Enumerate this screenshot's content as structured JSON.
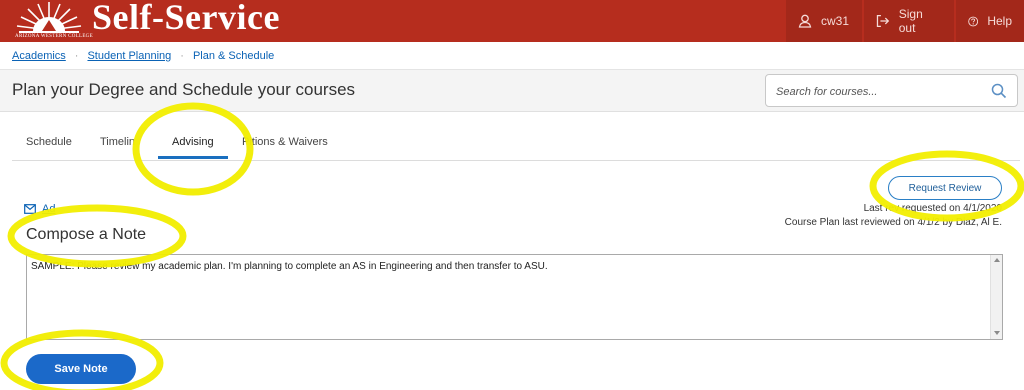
{
  "header": {
    "title": "Self-Service",
    "college_text": "ARIZONA WESTERN COLLEGE",
    "user_label": "cw31",
    "signout_label": "Sign out",
    "help_label": "Help"
  },
  "breadcrumb": {
    "items": [
      "Academics",
      "Student Planning",
      "Plan & Schedule"
    ],
    "separator": "·"
  },
  "page": {
    "title": "Plan your Degree and Schedule your courses"
  },
  "search": {
    "placeholder": "Search for courses..."
  },
  "tabs": [
    {
      "label": "Schedule"
    },
    {
      "label": "Timelin"
    },
    {
      "label": "Advising"
    },
    {
      "label": "Pitions & Waivers"
    }
  ],
  "advising": {
    "advisors_label": "Ad",
    "request_review_label": "Request Review",
    "last_review_requested": "Last rev   requested on 4/1/2020",
    "last_reviewed": "Course Plan last reviewed on 4/1/2     by Diaz, Al     E.",
    "compose_title": "Compose a Note",
    "note_text": "SAMPLE: Please review my academic plan.  I'm planning to complete an AS in Engineering and then transfer to ASU.",
    "save_label": "Save Note"
  },
  "colors": {
    "header_red": "#b62d1e",
    "link_blue": "#0a62b5",
    "primary_button": "#1b69c9",
    "highlight_yellow": "#f2ee00"
  }
}
